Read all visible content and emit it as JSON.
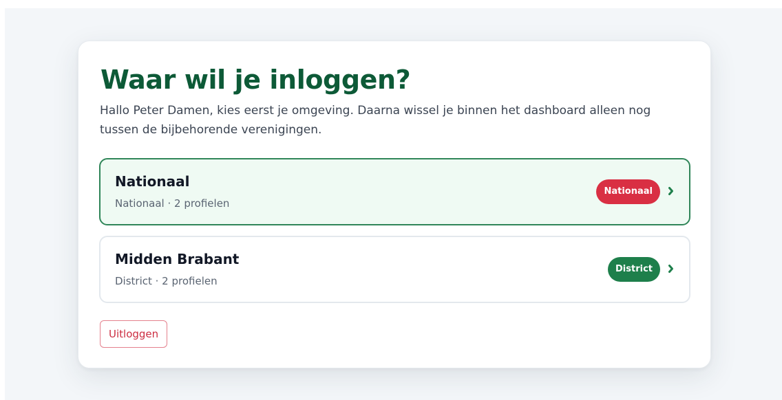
{
  "heading": "Waar wil je inloggen?",
  "intro": "Hallo Peter Damen, kies eerst je omgeving. Daarna wissel je binnen het dashboard alleen nog tussen de bijbehorende verenigingen.",
  "options": [
    {
      "title": "Nationaal",
      "meta": "Nationaal · 2 profielen",
      "badge": "Nationaal",
      "badge_color": "#d92f43",
      "selected": true,
      "chevron_icon": "chevron-right-icon"
    },
    {
      "title": "Midden Brabant",
      "meta": "District · 2 profielen",
      "badge": "District",
      "badge_color": "#1e7f4b",
      "selected": false,
      "chevron_icon": "chevron-right-icon"
    }
  ],
  "logout_label": "Uitloggen",
  "colors": {
    "heading": "#0d5a37",
    "selected_border": "#2f8558",
    "selected_background": "#effaf3",
    "logout": "#cc2d41",
    "page_background": "#f3f6f9"
  }
}
